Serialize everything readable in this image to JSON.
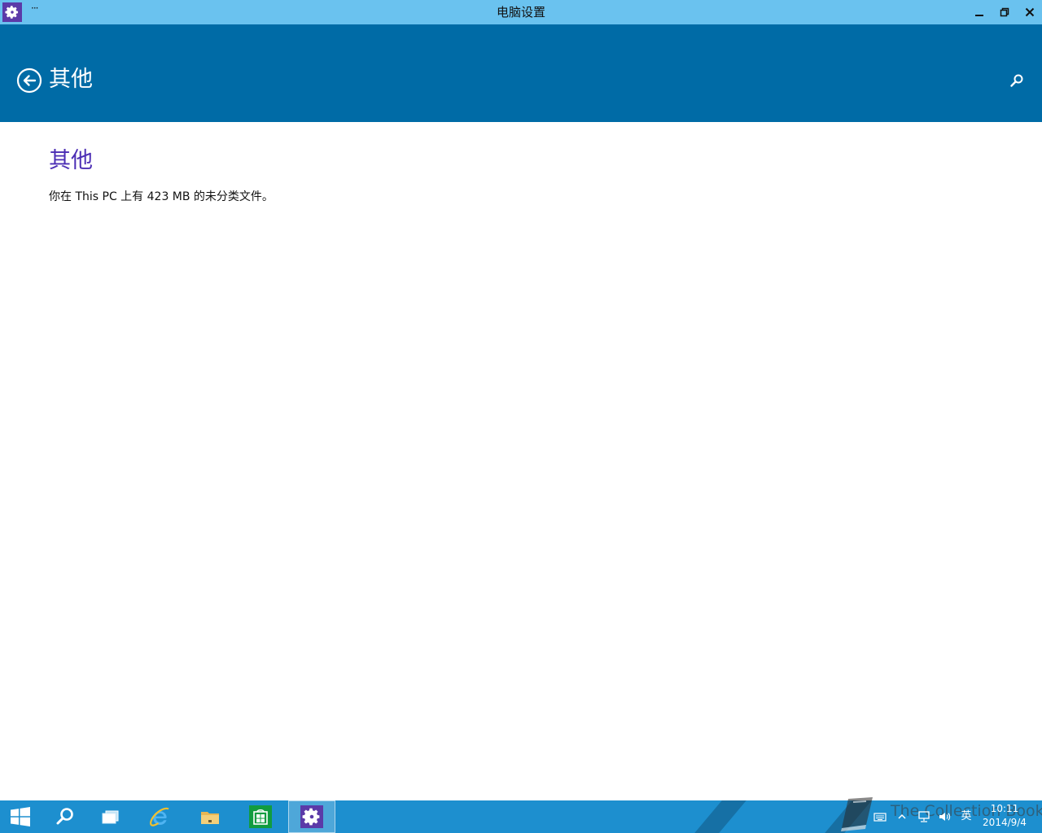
{
  "window": {
    "title": "电脑设置",
    "menu_dots": "···"
  },
  "header": {
    "title": "其他"
  },
  "content": {
    "heading": "其他",
    "description": "你在 This PC 上有 423 MB 的未分类文件。"
  },
  "taskbar": {
    "items": [
      "start",
      "search",
      "task-view",
      "internet-explorer",
      "file-explorer",
      "store",
      "pc-settings"
    ],
    "active_item": "pc-settings"
  },
  "tray": {
    "ime": "英",
    "time": "10:11",
    "date": "2014/9/4"
  },
  "watermark": {
    "text": "The Collection Book"
  },
  "colors": {
    "titlebar": "#6ac2ef",
    "header": "#006ba6",
    "heading": "#4b2db4",
    "taskbar": "#1d8fcf",
    "settings_tile": "#5b3aa8",
    "store_tile": "#119c3f"
  }
}
